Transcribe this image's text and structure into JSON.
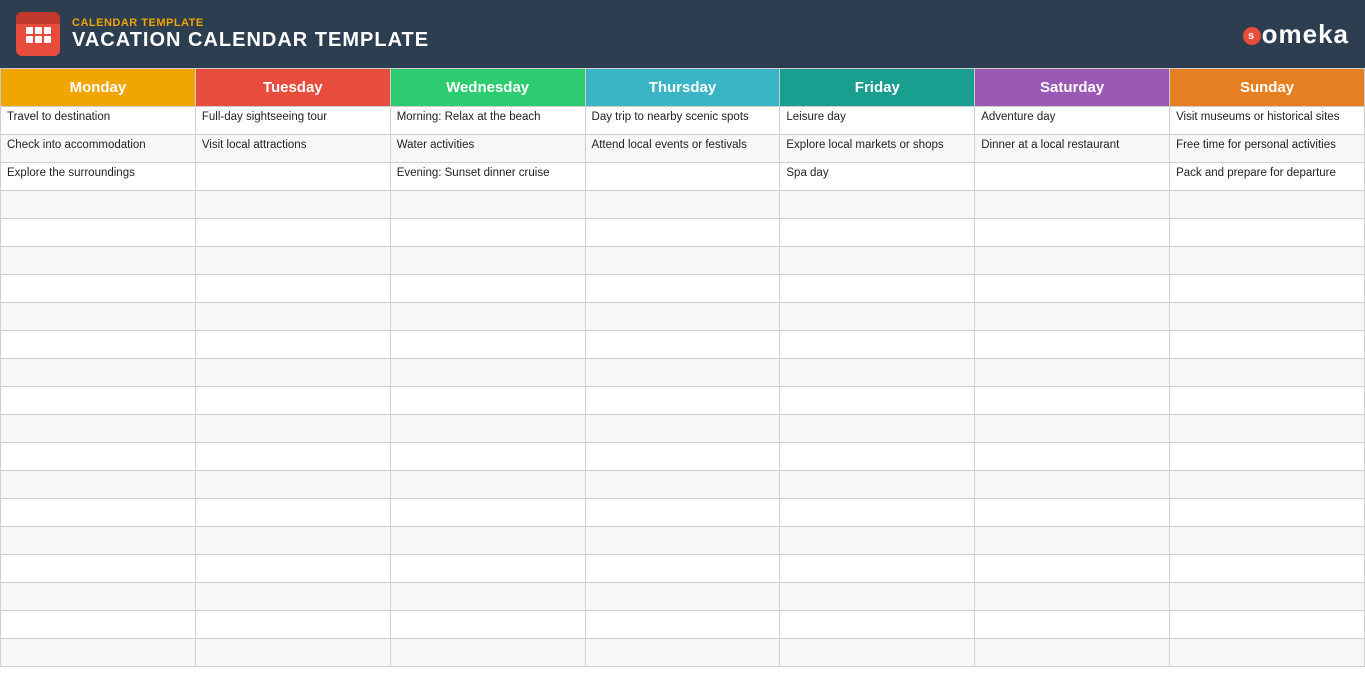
{
  "header": {
    "subtitle": "CALENDAR TEMPLATE",
    "title": "VACATION CALENDAR TEMPLATE",
    "logo": "someka"
  },
  "calendar": {
    "days": [
      {
        "label": "Monday",
        "class": "th-monday"
      },
      {
        "label": "Tuesday",
        "class": "th-tuesday"
      },
      {
        "label": "Wednesday",
        "class": "th-wednesday"
      },
      {
        "label": "Thursday",
        "class": "th-thursday"
      },
      {
        "label": "Friday",
        "class": "th-friday"
      },
      {
        "label": "Saturday",
        "class": "th-saturday"
      },
      {
        "label": "Sunday",
        "class": "th-sunday"
      }
    ],
    "rows": [
      [
        "Travel to destination",
        "Full-day sightseeing tour",
        "Morning: Relax at the beach",
        "Day trip to nearby scenic spots",
        "Leisure day",
        "Adventure day",
        "Visit museums or historical sites"
      ],
      [
        "Check into accommodation",
        "Visit local attractions",
        "Water activities",
        "Attend local events or festivals",
        "Explore local markets or shops",
        "Dinner at a local restaurant",
        "Free time for personal activities"
      ],
      [
        "Explore the surroundings",
        "",
        "Evening: Sunset dinner cruise",
        "",
        "Spa day",
        "",
        "Pack and prepare for departure"
      ],
      [
        "",
        "",
        "",
        "",
        "",
        "",
        ""
      ],
      [
        "",
        "",
        "",
        "",
        "",
        "",
        ""
      ],
      [
        "",
        "",
        "",
        "",
        "",
        "",
        ""
      ],
      [
        "",
        "",
        "",
        "",
        "",
        "",
        ""
      ],
      [
        "",
        "",
        "",
        "",
        "",
        "",
        ""
      ],
      [
        "",
        "",
        "",
        "",
        "",
        "",
        ""
      ],
      [
        "",
        "",
        "",
        "",
        "",
        "",
        ""
      ],
      [
        "",
        "",
        "",
        "",
        "",
        "",
        ""
      ],
      [
        "",
        "",
        "",
        "",
        "",
        "",
        ""
      ],
      [
        "",
        "",
        "",
        "",
        "",
        "",
        ""
      ],
      [
        "",
        "",
        "",
        "",
        "",
        "",
        ""
      ],
      [
        "",
        "",
        "",
        "",
        "",
        "",
        ""
      ],
      [
        "",
        "",
        "",
        "",
        "",
        "",
        ""
      ],
      [
        "",
        "",
        "",
        "",
        "",
        "",
        ""
      ],
      [
        "",
        "",
        "",
        "",
        "",
        "",
        ""
      ],
      [
        "",
        "",
        "",
        "",
        "",
        "",
        ""
      ],
      [
        "",
        "",
        "",
        "",
        "",
        "",
        ""
      ]
    ]
  }
}
